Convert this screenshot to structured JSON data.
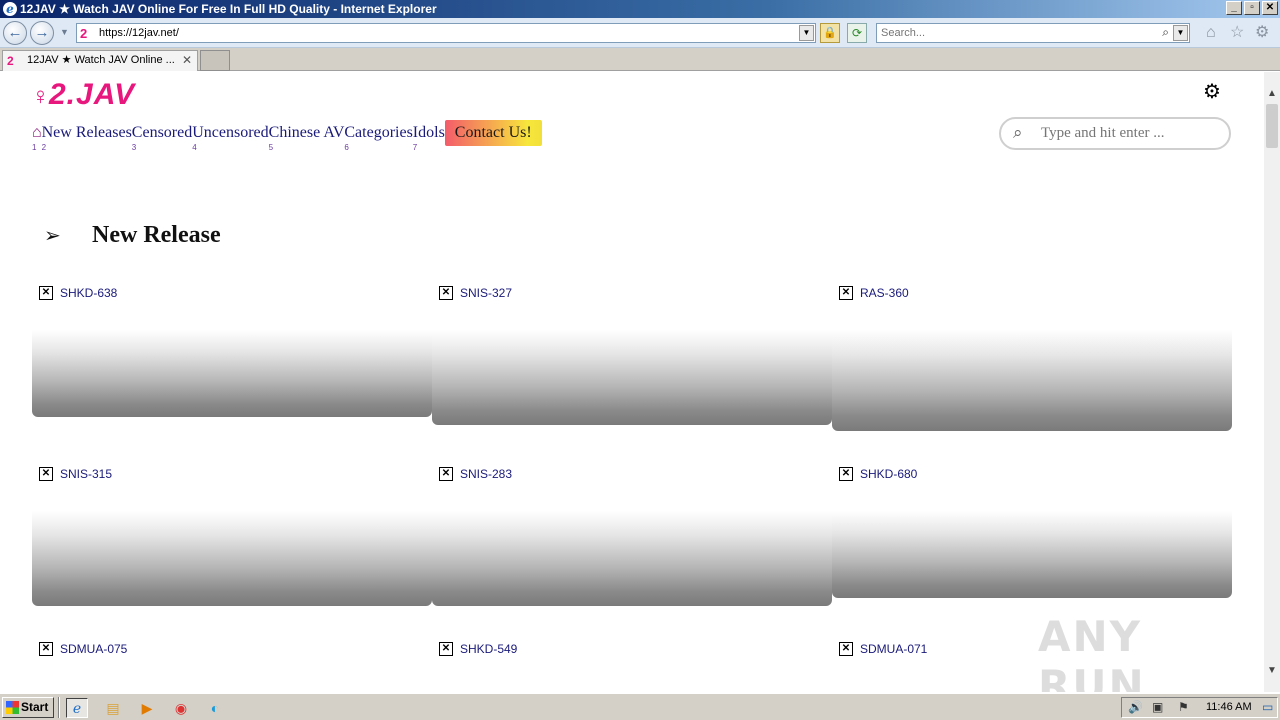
{
  "window": {
    "title": "12JAV ★ Watch JAV Online For Free In Full HD Quality - Internet Explorer",
    "controls": {
      "minimize": "_",
      "maximize": "▫",
      "close": "✕"
    }
  },
  "toolbar": {
    "address_url": "https://12jav.net/",
    "search_placeholder": "Search...",
    "favicon_text": "2"
  },
  "tabs": [
    {
      "label": "12JAV ★ Watch JAV Online ...",
      "active": true
    }
  ],
  "site": {
    "logo_text": "2.JAV",
    "nav": {
      "items": [
        {
          "label": "New Releases",
          "num": "2"
        },
        {
          "label": "Censored",
          "num": "3"
        },
        {
          "label": "Uncensored",
          "num": "4"
        },
        {
          "label": "Chinese AV",
          "num": "5"
        },
        {
          "label": "Categories",
          "num": "6"
        },
        {
          "label": "Idols",
          "num": "7"
        }
      ],
      "home_num": "1",
      "contact_label": "Contact Us!"
    },
    "search_placeholder": "Type and hit enter ...",
    "section_title": "New Release",
    "videos": [
      {
        "code": "SHKD-638"
      },
      {
        "code": "SNIS-327"
      },
      {
        "code": "RAS-360"
      },
      {
        "code": "SNIS-315"
      },
      {
        "code": "SNIS-283"
      },
      {
        "code": "SHKD-680"
      },
      {
        "code": "SDMUA-075"
      },
      {
        "code": "SHKD-549"
      },
      {
        "code": "SDMUA-071"
      }
    ]
  },
  "watermark": "ANY RUN",
  "taskbar": {
    "start_label": "Start",
    "clock": "11:46 AM"
  }
}
